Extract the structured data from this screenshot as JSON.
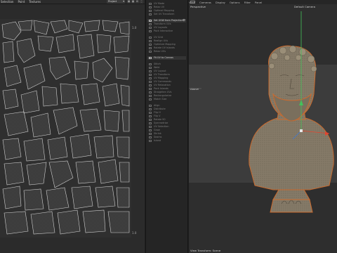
{
  "uv_editor": {
    "menu": [
      "Selection",
      "Point",
      "Textures"
    ],
    "mode_select": "Project",
    "scale_label_top": "1.0",
    "scale_label_bottom": "1.0"
  },
  "tools": {
    "top_items": [
      "UV Mode",
      "Relax UV",
      "Optimal Mapping",
      "Set UV Transform",
      "Transform UVs",
      "UV Layouts",
      "Pack Interactive"
    ],
    "highlight_1": "Set UVW from Projection",
    "mid_items": [
      "UV Grid",
      "Realign UVs",
      "Optimize Mapping",
      "Rotate UV Islands",
      "Relax UVs"
    ],
    "highlight_2": "Fit UV to Canvas",
    "lower_items": [
      "Stitch",
      "Weld",
      "UV Layout",
      "UV Transform",
      "UV Mapping",
      "UV Commands",
      "UV Relaxation",
      "Pack Islands",
      "Straighten UVs",
      "Rectangularize",
      "Match Size",
      "Align",
      "Distribute",
      "Flip H",
      "Flip V",
      "Rotate 90",
      "Symmetrize",
      "UV Selection",
      "Grow",
      "Shrink",
      "Seams",
      "Island"
    ]
  },
  "viewport": {
    "menu": [
      "View",
      "Cameras",
      "Display",
      "Options",
      "Filter",
      "Panel"
    ],
    "label_perspective": "Perspective",
    "label_camera": "Default Camera",
    "label_above": "Above",
    "footer": "View Transform: Scene"
  },
  "colors": {
    "uv_line": "#c8c8c8",
    "axis_y": "#43c25a",
    "axis_x": "#e0452f",
    "axis_z": "#3d7bd8",
    "bust_outline": "#c96a2e"
  }
}
